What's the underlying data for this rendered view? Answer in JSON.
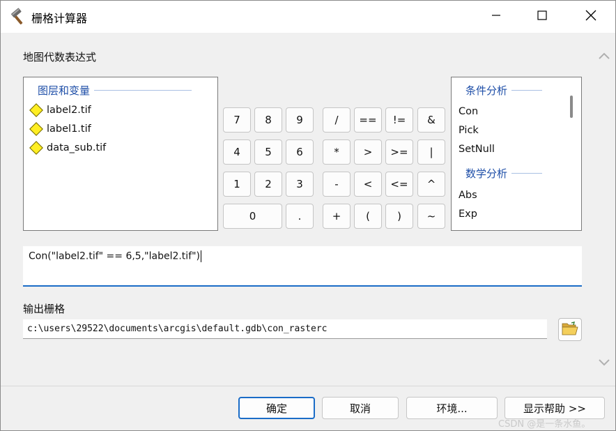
{
  "window": {
    "title": "栅格计算器"
  },
  "expression_section": {
    "label": "地图代数表达式"
  },
  "layers_panel": {
    "heading": "图层和变量",
    "items": [
      "label2.tif",
      "label1.tif",
      "data_sub.tif"
    ]
  },
  "calculator": {
    "buttons": [
      "7",
      "8",
      "9",
      "/",
      "==",
      "!=",
      "&",
      "4",
      "5",
      "6",
      "*",
      ">",
      ">=",
      "|",
      "1",
      "2",
      "3",
      "-",
      "<",
      "<=",
      "^",
      "0",
      ".",
      "+",
      "(",
      ")",
      "~"
    ]
  },
  "functions_panel": {
    "group1": {
      "heading": "条件分析",
      "items": [
        "Con",
        "Pick",
        "SetNull"
      ]
    },
    "group2": {
      "heading": "数学分析",
      "items": [
        "Abs",
        "Exp"
      ]
    }
  },
  "expression": {
    "value": "Con(\"label2.tif\" == 6,5,\"label2.tif\")"
  },
  "output": {
    "label": "输出栅格",
    "path": "c:\\users\\29522\\documents\\arcgis\\default.gdb\\con_rasterc"
  },
  "buttons": {
    "ok": "确定",
    "cancel": "取消",
    "env": "环境...",
    "help": "显示帮助 >>"
  },
  "watermark": "CSDN @是一条水鱼。",
  "icons": {
    "app": "hammer-icon",
    "minimize": "minimize-icon",
    "maximize": "maximize-icon",
    "close": "close-icon",
    "folder": "folder-open-icon",
    "scroll_up": "chevron-up-icon",
    "scroll_down": "chevron-down-icon"
  }
}
